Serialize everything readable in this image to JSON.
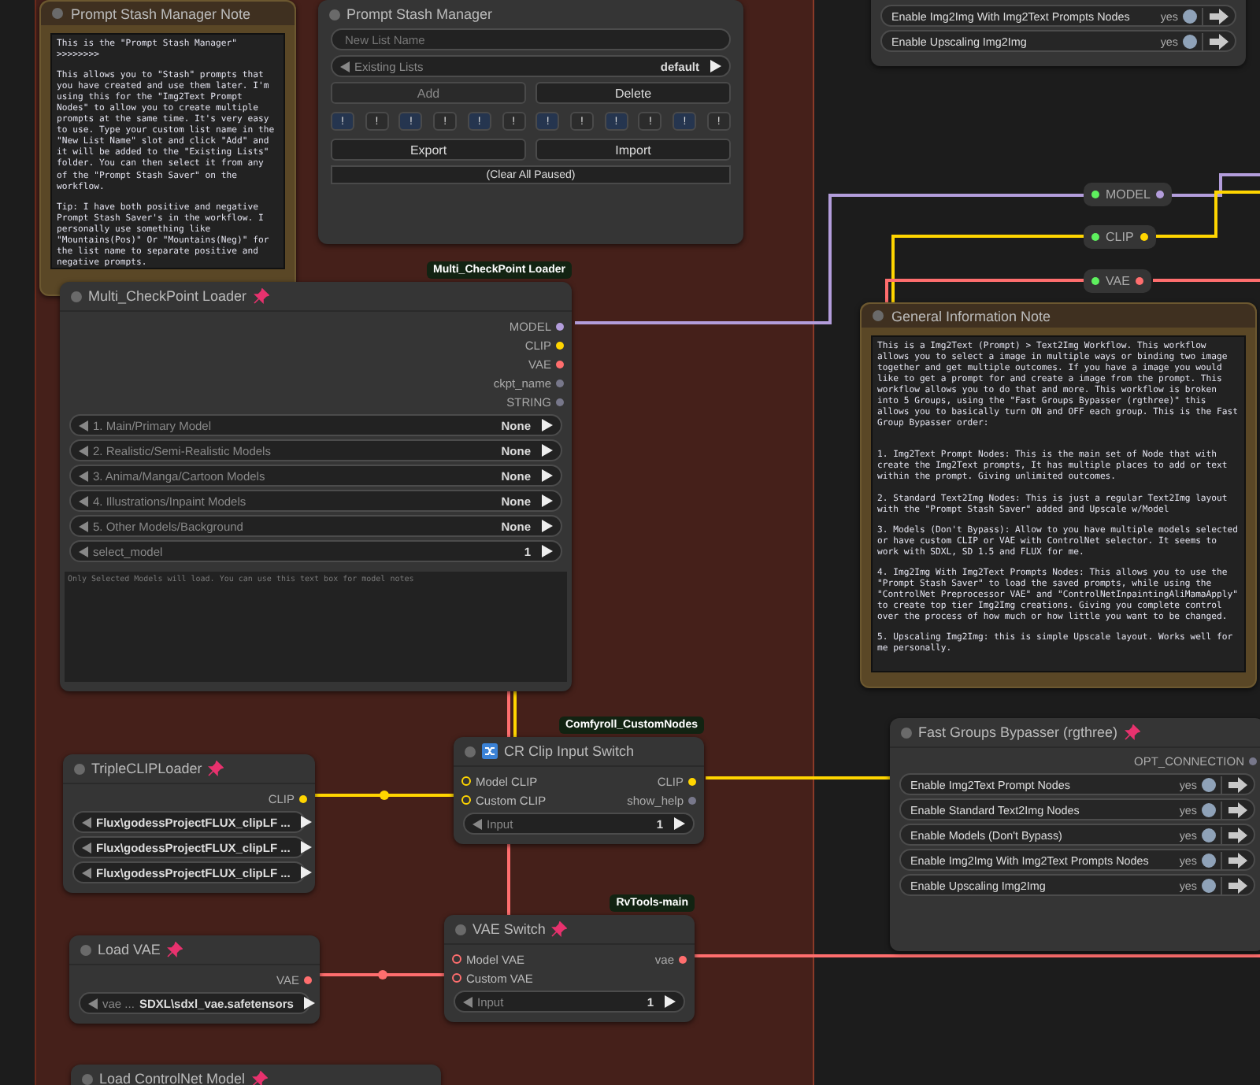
{
  "prompt_stash_note": {
    "title": "Prompt Stash Manager Note",
    "paragraphs": [
      "This is the \"Prompt Stash Manager\" >>>>>>>>",
      "This allows you to \"Stash\" prompts that you have created and use them later. I'm using this for the \"Img2Text Prompt Nodes\" to allow you to create multiple prompts at the same time. It's very easy to use. Type your custom list name in the \"New List Name\" slot and click \"Add\" and it will be added to the \"Existing Lists\" folder. You can then select it from any of the \"Prompt Stash Saver\" on the workflow.",
      "Tip: I have both positive and negative Prompt Stash Saver's in the workflow. I personally use something like \"Mountains(Pos)\" Or \"Mountains(Neg)\" for the list name to separate positive and negative prompts."
    ]
  },
  "prompt_stash_manager": {
    "title": "Prompt Stash Manager",
    "new_list": {
      "placeholder": "New List Name"
    },
    "existing_lists": {
      "label": "Existing Lists",
      "value": "default"
    },
    "actions": [
      {
        "label": "Add",
        "disabled": true
      },
      {
        "label": "Delete",
        "disabled": false
      }
    ],
    "slots": [
      {
        "label": "!",
        "active": true
      },
      {
        "label": "!",
        "active": false
      },
      {
        "label": "!",
        "active": true
      },
      {
        "label": "!",
        "active": false
      },
      {
        "label": "!",
        "active": true
      },
      {
        "label": "!",
        "active": false
      },
      {
        "label": "!",
        "active": true
      },
      {
        "label": "!",
        "active": false
      },
      {
        "label": "!",
        "active": true
      },
      {
        "label": "!",
        "active": false
      },
      {
        "label": "!",
        "active": true
      },
      {
        "label": "!",
        "active": false
      }
    ],
    "transfer": [
      "Export",
      "Import"
    ],
    "clear": "(Clear All Paused)"
  },
  "fast_groups_top": {
    "rows": [
      {
        "label": "Enable Img2Img With Img2Text Prompts Nodes",
        "value": "yes",
        "on": true
      },
      {
        "label": "Enable Upscaling Img2Img",
        "value": "yes",
        "on": true
      }
    ]
  },
  "reroutes": [
    {
      "label": "MODEL",
      "color": "#b39ddb"
    },
    {
      "label": "CLIP",
      "color": "#ffd500"
    },
    {
      "label": "VAE",
      "color": "#ff6e6e"
    }
  ],
  "general_note": {
    "title": "General Information Note",
    "paragraphs": [
      "This is a Img2Text (Prompt) > Text2Img Workflow. This workflow allows you to select a image in multiple ways or binding two image together and get multiple outcomes. If you have a image you would like to get a prompt for and create a image from the prompt. This workflow allows you to do that and more. This workflow is broken into 5 Groups, using the \"Fast Groups Bypasser (rgthree)\" this allows you to basically turn ON and OFF each group. This is the Fast Group Bypasser order:",
      "1. Img2Text Prompt Nodes: This is the main set of Node that with create the Img2Text prompts, It has multiple places to add or text within the prompt. Giving unlimited outcomes.",
      "2. Standard Text2Img Nodes: This is just a regular Text2Img layout with the \"Prompt Stash Saver\" added and Upscale w/Model",
      "3. Models (Don't Bypass): Allow to you have multiple models selected or have custom CLIP or VAE with ControlNet selector. It seems to work with SDXL, SD 1.5 and FLUX for me.",
      "4. Img2Img With Img2Text Prompts Nodes: This allows you to use the \"Prompt Stash Saver\" to load the saved prompts, while using the \"ControlNet Preprocessor VAE\" and \"ControlNetInpaintingAliMamaApply\" to create top tier Img2Img creations. Giving you complete control over the process of how much or how little you want to be changed.",
      "5. Upscaling Img2Img: this is simple Upscale layout. Works well for me personally."
    ]
  },
  "nodes": [
    {
      "badge": "Multi_CheckPoint Loader",
      "title": "Multi_CheckPoint Loader",
      "pinned": true,
      "rows": [
        {
          "output": {
            "label": "MODEL",
            "color": "#b39ddb"
          }
        },
        {
          "output": {
            "label": "CLIP",
            "color": "#ffd500"
          }
        },
        {
          "output": {
            "label": "VAE",
            "color": "#ff6e6e"
          }
        },
        {
          "output": {
            "label": "ckpt_name",
            "color": "#77778a"
          }
        },
        {
          "output": {
            "label": "STRING",
            "color": "#77778a"
          }
        }
      ],
      "widgets": [
        {
          "label": "1. Main/Primary Model",
          "value": "None"
        },
        {
          "label": "2. Realistic/Semi-Realistic Models",
          "value": "None"
        },
        {
          "label": "3. Anima/Manga/Cartoon Models",
          "value": "None"
        },
        {
          "label": "4. Illustrations/Inpaint Models",
          "value": "None"
        },
        {
          "label": "5. Other Models/Background",
          "value": "None"
        },
        {
          "label": "select_model",
          "value": "1"
        }
      ],
      "notes": "Only Selected Models will load. You can use this text box for model notes"
    },
    {
      "title": "TripleCLIPLoader",
      "pinned": true,
      "rows": [
        {
          "output": {
            "label": "CLIP",
            "color": "#ffd500"
          }
        }
      ],
      "widgets": [
        {
          "value": "Flux\\godessProjectFLUX_clipLF ..."
        },
        {
          "value": "Flux\\godessProjectFLUX_clipLF ..."
        },
        {
          "value": "Flux\\godessProjectFLUX_clipLF ..."
        }
      ]
    },
    {
      "badge": "Comfyroll_CustomNodes",
      "title": "CR Clip Input Switch",
      "pinned": false,
      "rows": [
        {
          "input": {
            "label": "Model CLIP",
            "color": "#ffd500"
          },
          "output": {
            "label": "CLIP",
            "color": "#ffd500"
          }
        },
        {
          "input": {
            "label": "Custom CLIP",
            "color": "#ffd500"
          },
          "output": {
            "label": "show_help",
            "color": "#77778a"
          }
        }
      ],
      "widgets": [
        {
          "label": "Input",
          "value": "1"
        }
      ]
    },
    {
      "title": "Load VAE",
      "pinned": true,
      "rows": [
        {
          "output": {
            "label": "VAE",
            "color": "#ff6e6e"
          }
        }
      ],
      "widgets": [
        {
          "label": "vae ...",
          "value": "SDXL\\sdxl_vae.safetensors"
        }
      ]
    },
    {
      "badge": "RvTools-main",
      "title": "VAE Switch",
      "pinned": true,
      "rows": [
        {
          "input": {
            "label": "Model VAE",
            "color": "#ff6e6e"
          },
          "output": {
            "label": "vae",
            "color": "#ff6e6e"
          }
        },
        {
          "input": {
            "label": "Custom VAE",
            "color": "#ff6e6e"
          }
        }
      ],
      "widgets": [
        {
          "label": "Input",
          "value": "1"
        }
      ]
    },
    {
      "title": "Load ControlNet Model",
      "pinned": true
    }
  ],
  "fast_groups_bypasser": {
    "title": "Fast Groups Bypasser (rgthree)",
    "pinned": true,
    "output": "OPT_CONNECTION",
    "rows": [
      {
        "label": "Enable Img2Text Prompt Nodes",
        "value": "yes",
        "on": true
      },
      {
        "label": "Enable Standard Text2Img Nodes",
        "value": "yes",
        "on": true
      },
      {
        "label": "Enable Models (Don't Bypass)",
        "value": "yes",
        "on": true
      },
      {
        "label": "Enable Img2Img With Img2Text Prompts Nodes",
        "value": "yes",
        "on": true
      },
      {
        "label": "Enable Upscaling Img2Img",
        "value": "yes",
        "on": true
      }
    ]
  }
}
